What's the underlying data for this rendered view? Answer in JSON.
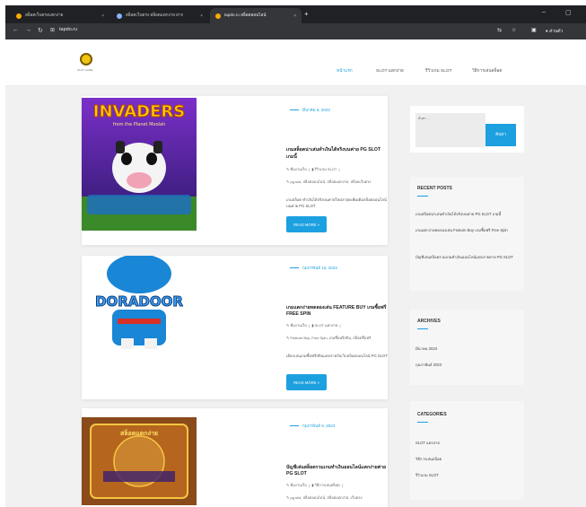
{
  "browser": {
    "tabs": [
      {
        "label": "สล็อตเว็บตรงแตกง่าย"
      },
      {
        "label": "สล็อตเว็บตรง สล็อตแตกง่าย ฝาก"
      },
      {
        "label": "tapdo.ru สล็อตออนไลน์"
      }
    ],
    "new_tab": "+",
    "url": "tapdo.ru",
    "profile_label": "ส่วนตัว"
  },
  "site": {
    "logo_sub": "SLOT GAME",
    "nav": [
      "หน้าแรก",
      "SLOT แตกง่าย",
      "รีวิวเกม SLOT",
      "วิธีการเล่นสล็อต"
    ]
  },
  "posts": [
    {
      "date": "มีนาคม 6, 2023",
      "title": "เกมสล็อตน่าเล่นทำเงินได้จริงบนค่าย PG SLOT เกมนี้",
      "author": "ทีมงานเว็บ",
      "category": "รีวิวเกม SLOT",
      "tags": "pg slot, สล็อตออนไลน์, สล็อตแตกง่าย, สล็อตเว็บตรง",
      "excerpt": "เกมสล็อต ทำเงินได้จริงบนค่ายใหม่ล่าสุดเพิ่มเติมสล็อตออนไลน์บนค่าย PG SLOT",
      "readmore": "READ MORE »",
      "thumb_title": "INVADERS",
      "thumb_sub": "from the Planet Moolah"
    },
    {
      "date": "กุมภาพันธ์ 16, 2023",
      "title": "เกมแตกง่ายทดลองเล่น FEATURE BUY เกมซื้อฟรี FREE SPIN",
      "author": "ทีมงานเว็บ",
      "category": "SLOT แตกง่าย",
      "tags": "Feature Buy, Free Spin, เกมซื้อฟรีสปิน, สล็อตซื้อฟรี",
      "excerpt": "เลือกเล่นเกมซื้อฟรีสปินแตกง่ายกับเว็บสล็อตออนไลน์ PG SLOT",
      "readmore": "READ MORE »",
      "thumb_title": "DORADOOR"
    },
    {
      "date": "กุมภาพันธ์ 9, 2023",
      "title": "บัญชีเล่นสล็อตรวมเกมทำเงินออนไลน์แตกง่ายค่าย PG SLOT",
      "author": "ทีมงานเว็บ",
      "category": "วิธีการเล่นสล็อต",
      "tags": "pg slot, สล็อตออนไลน์, สล็อตแตกง่าย, เว็บตรง",
      "thumb_title": "สล็อตแตกง่าย"
    }
  ],
  "sidebar": {
    "search_label": "ค้นหา …",
    "search_button": "ค้นหา",
    "recent": {
      "title": "RECENT POSTS",
      "items": [
        "เกมสล็อตน่าเล่นทำเงินได้จริงบนค่าย PG SLOT เกมนี้",
        "เกมแตกง่ายทดลองเล่น Feature Buy เกมซื้อฟรี Free Spin",
        "บัญชีเล่นสล็อตรวมเกมทำเงินออนไลน์แตกง่ายค่าย PG SLOT"
      ]
    },
    "archives": {
      "title": "ARCHIVES",
      "items": [
        "มีนาคม 2023",
        "กุมภาพันธ์ 2023"
      ]
    },
    "categories": {
      "title": "CATEGORIES",
      "items": [
        "SLOT แตกง่าย",
        "วิธีการเล่นสล็อต",
        "รีวิวเกม SLOT"
      ]
    }
  },
  "colors": {
    "accent": "#1ca0e0",
    "chrome_dark": "#202124",
    "chrome_mid": "#35363a"
  }
}
